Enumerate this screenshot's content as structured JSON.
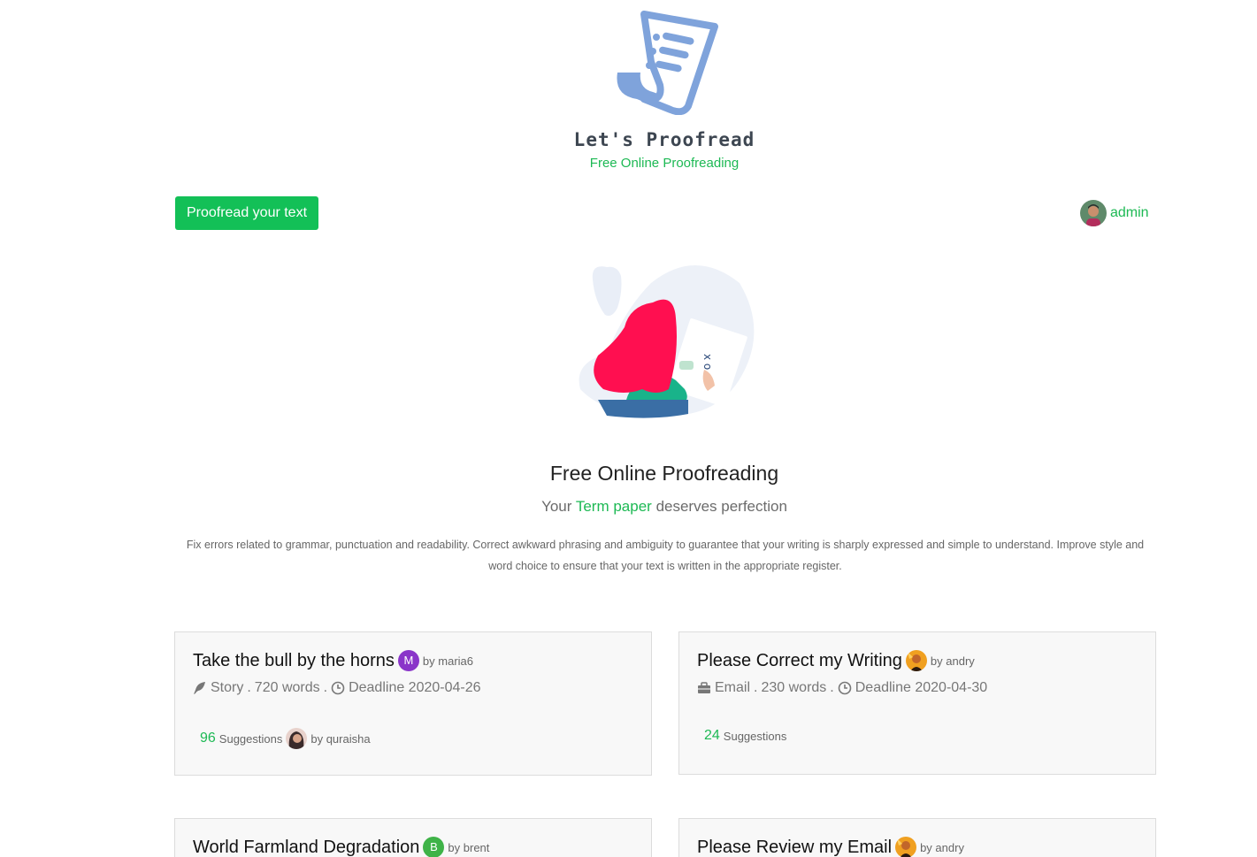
{
  "brand": {
    "title": "Let's Proofread",
    "subtitle": "Free Online Proofreading"
  },
  "header": {
    "cta_label": "Proofread your text",
    "user_name": "admin"
  },
  "hero": {
    "title": "Free Online Proofreading",
    "tag_prefix": "Your",
    "tag_highlight": "Term paper",
    "tag_suffix": "deserves perfection",
    "description": "Fix errors related to grammar, punctuation and readability. Correct awkward phrasing and ambiguity to guarantee that your writing is sharply expressed and simple to understand. Improve style and word choice to ensure that your text is written in the appropriate register."
  },
  "requests": [
    {
      "title": "Take the bull by the horns",
      "author_initial": "M",
      "author_color": "#8a35c9",
      "author": "by maria6",
      "type_icon": "feather-icon",
      "type": "Story",
      "words": "720 words",
      "deadline": "Deadline 2020-04-26",
      "suggestions_count": "96",
      "suggestions_label": "Suggestions",
      "suggested_by": "by quraisha"
    },
    {
      "title": "Please Correct my Writing",
      "author": "by andry",
      "type_icon": "briefcase-icon",
      "type": "Email",
      "words": "230 words",
      "deadline": "Deadline 2020-04-30",
      "suggestions_count": "24",
      "suggestions_label": "Suggestions"
    },
    {
      "title": "World Farmland Degradation",
      "author_initial": "B",
      "author_color": "#3fb348",
      "author": "by brent"
    },
    {
      "title": "Please Review my Email",
      "author": "by andry"
    }
  ],
  "separators": {
    "dot": "."
  }
}
